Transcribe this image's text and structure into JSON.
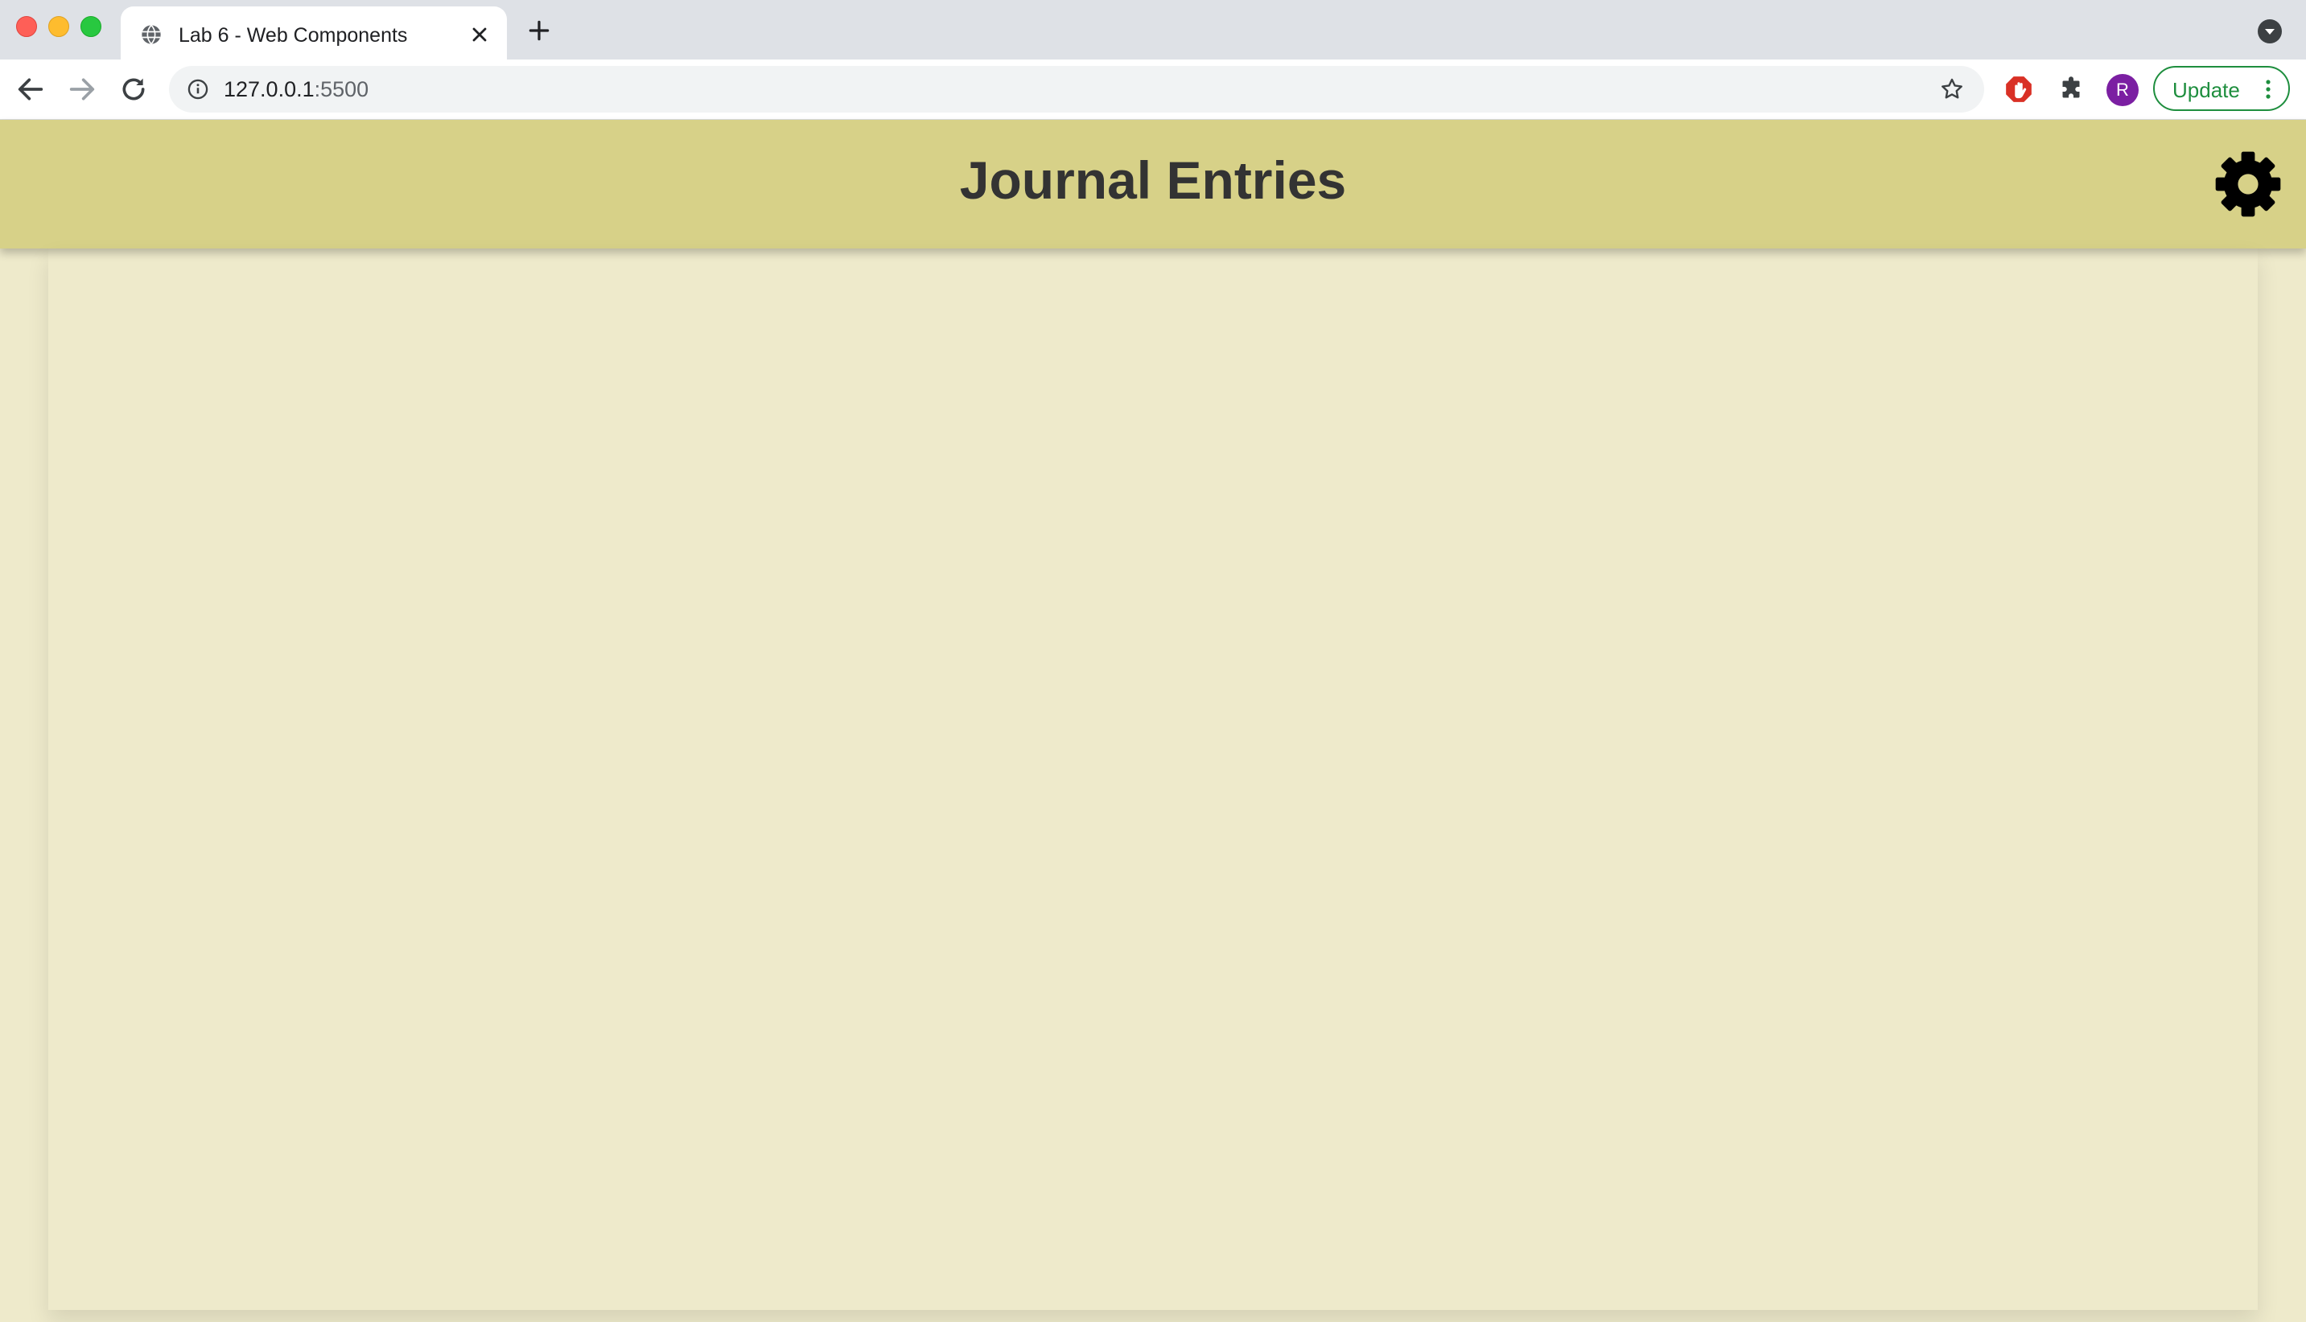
{
  "browser": {
    "tab_title": "Lab 6 - Web Components",
    "url_host": "127.0.0.1",
    "url_port": ":5500",
    "avatar_initial": "R",
    "update_label": "Update"
  },
  "app": {
    "title": "Journal Entries"
  },
  "icons": {
    "globe": "globe-icon",
    "settings": "gear-icon"
  },
  "colors": {
    "header_bg": "#d7d188",
    "page_bg": "#eeeacb",
    "title_text": "#333333"
  }
}
